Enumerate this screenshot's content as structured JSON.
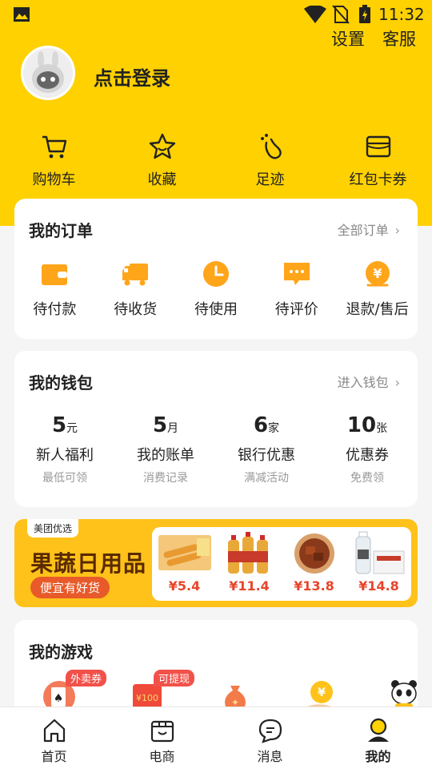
{
  "status_bar": {
    "time": "11:32"
  },
  "header": {
    "settings_label": "设置",
    "service_label": "客服",
    "login_label": "点击登录"
  },
  "quick_actions": [
    {
      "label": "购物车",
      "icon": "cart-icon"
    },
    {
      "label": "收藏",
      "icon": "star-icon"
    },
    {
      "label": "足迹",
      "icon": "footprint-icon"
    },
    {
      "label": "红包卡券",
      "icon": "wallet-card-icon"
    }
  ],
  "orders": {
    "title": "我的订单",
    "more": "全部订单",
    "items": [
      {
        "label": "待付款",
        "icon": "wallet-icon"
      },
      {
        "label": "待收货",
        "icon": "truck-icon"
      },
      {
        "label": "待使用",
        "icon": "clock-icon"
      },
      {
        "label": "待评价",
        "icon": "comment-icon"
      },
      {
        "label": "退款/售后",
        "icon": "refund-icon"
      }
    ]
  },
  "wallet": {
    "title": "我的钱包",
    "more": "进入钱包",
    "items": [
      {
        "num": "5",
        "unit": "元",
        "label": "新人福利",
        "sub": "最低可领"
      },
      {
        "num": "5",
        "unit": "月",
        "label": "我的账单",
        "sub": "消费记录"
      },
      {
        "num": "6",
        "unit": "家",
        "label": "银行优惠",
        "sub": "满减活动"
      },
      {
        "num": "10",
        "unit": "张",
        "label": "优惠券",
        "sub": "免费领"
      }
    ]
  },
  "banner": {
    "brand": "美团优选",
    "headline": "果蔬日用品",
    "pill": "便宜有好货",
    "products": [
      {
        "price": "¥5.4"
      },
      {
        "price": "¥11.4"
      },
      {
        "price": "¥13.8"
      },
      {
        "price": "¥14.8"
      }
    ]
  },
  "games": {
    "title": "我的游戏",
    "badges": [
      "外卖券",
      "可提现"
    ]
  },
  "tabbar": [
    {
      "label": "首页",
      "icon": "home-icon"
    },
    {
      "label": "电商",
      "icon": "shop-icon"
    },
    {
      "label": "消息",
      "icon": "message-icon"
    },
    {
      "label": "我的",
      "icon": "profile-icon",
      "active": true
    }
  ],
  "colors": {
    "brand_yellow": "#FFD100",
    "accent_orange": "#FFA51A",
    "price_red": "#e8442a"
  }
}
